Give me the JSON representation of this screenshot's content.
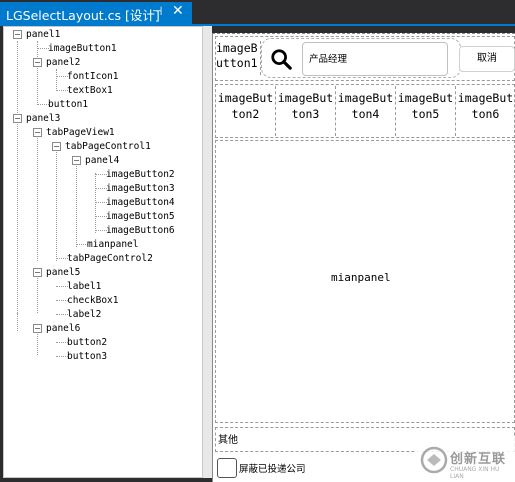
{
  "tab": {
    "title": "LGSelectLayout.cs [设计]",
    "pin_glyph": "⊣",
    "close_glyph": "✕"
  },
  "tree": {
    "nodes": [
      {
        "label": "panel1",
        "expander": "−"
      },
      {
        "label": "imageButton1"
      },
      {
        "label": "panel2",
        "expander": "−"
      },
      {
        "label": "fontIcon1"
      },
      {
        "label": "textBox1"
      },
      {
        "label": "button1"
      },
      {
        "label": "panel3",
        "expander": "−"
      },
      {
        "label": "tabPageView1",
        "expander": "−"
      },
      {
        "label": "tabPageControl1",
        "expander": "−"
      },
      {
        "label": "panel4",
        "expander": "−"
      },
      {
        "label": "imageButton2"
      },
      {
        "label": "imageButton3"
      },
      {
        "label": "imageButton4"
      },
      {
        "label": "imageButton5"
      },
      {
        "label": "imageButton6"
      },
      {
        "label": "mianpanel"
      },
      {
        "label": "tabPageControl2"
      },
      {
        "label": "panel5",
        "expander": "−"
      },
      {
        "label": "label1"
      },
      {
        "label": "checkBox1"
      },
      {
        "label": "label2"
      },
      {
        "label": "panel6",
        "expander": "−"
      },
      {
        "label": "button2"
      },
      {
        "label": "button3"
      }
    ]
  },
  "designer": {
    "image_button1": [
      "imageB",
      "utton1"
    ],
    "search_placeholder": "产品经理",
    "cancel_label": "取消",
    "image_buttons": [
      {
        "l1": "imageBut",
        "l2": "ton2"
      },
      {
        "l1": "imageBut",
        "l2": "ton3"
      },
      {
        "l1": "imageBut",
        "l2": "ton4"
      },
      {
        "l1": "imageBut",
        "l2": "ton5"
      },
      {
        "l1": "imageBut",
        "l2": "ton6"
      }
    ],
    "main_panel_label": "mianpanel",
    "other_label": "其他",
    "checkbox_label": "屏蔽已投递公司"
  },
  "watermark": {
    "cn": "创新互联",
    "en": "CHUANG XIN HU LIAN"
  },
  "colors": {
    "accent": "#007acc",
    "ide_bg": "#2d2d30",
    "panel_bg": "#ffffff"
  }
}
